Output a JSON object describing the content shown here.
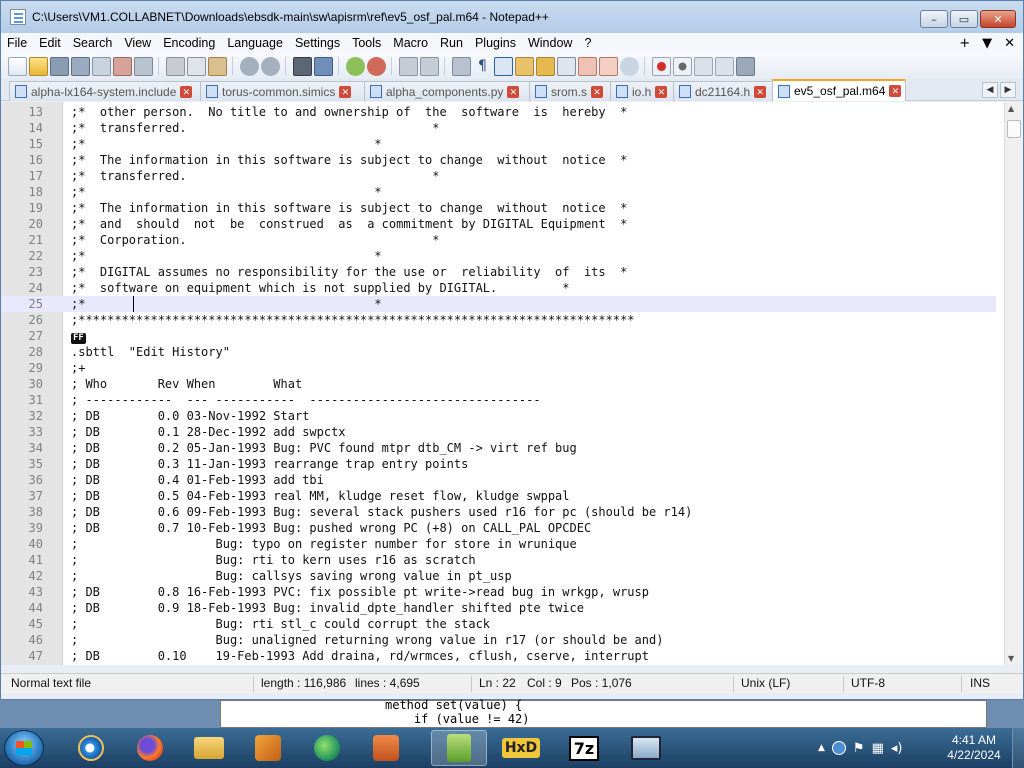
{
  "window": {
    "title": "C:\\Users\\VM1.COLLABNET\\Downloads\\ebsdk-main\\sw\\apisrm\\ref\\ev5_osf_pal.m64 - Notepad++",
    "min": "–",
    "max": "▭",
    "close": "✕"
  },
  "menu": [
    "File",
    "Edit",
    "Search",
    "View",
    "Encoding",
    "Language",
    "Settings",
    "Tools",
    "Macro",
    "Run",
    "Plugins",
    "Window",
    "?"
  ],
  "menu_right": {
    "plus": "+",
    "down": "▼",
    "close": "✕"
  },
  "tabs": [
    {
      "label": "alpha-lx164-system.include"
    },
    {
      "label": "torus-common.simics"
    },
    {
      "label": "alpha_components.py"
    },
    {
      "label": "srom.s"
    },
    {
      "label": "io.h"
    },
    {
      "label": "dc21164.h"
    },
    {
      "label": "ev5_osf_pal.m64",
      "active": true
    }
  ],
  "tab_nav": {
    "left": "◀",
    "right": "▶"
  },
  "editor": {
    "current_line": 25,
    "lines": [
      {
        "n": "13",
        "t": ";*  other person.  No title to and ownership of  the  software  is  hereby  *"
      },
      {
        "n": "14",
        "t": ";*  transferred.                                  *"
      },
      {
        "n": "15",
        "t": ";*                                        *"
      },
      {
        "n": "16",
        "t": ";*  The information in this software is subject to change  without  notice  *"
      },
      {
        "n": "17",
        "t": ";*  transferred.                                  *"
      },
      {
        "n": "18",
        "t": ";*                                        *"
      },
      {
        "n": "19",
        "t": ";*  The information in this software is subject to change  without  notice  *"
      },
      {
        "n": "20",
        "t": ";*  and  should  not  be  construed  as  a commitment by DIGITAL Equipment  *"
      },
      {
        "n": "21",
        "t": ";*  Corporation.                                  *"
      },
      {
        "n": "22",
        "t": ";*                                        *"
      },
      {
        "n": "23",
        "t": ";*  DIGITAL assumes no responsibility for the use or  reliability  of  its  *"
      },
      {
        "n": "24",
        "t": ";*  software on equipment which is not supplied by DIGITAL.         *"
      },
      {
        "n": "25",
        "t": ";*                                        *"
      },
      {
        "n": "26",
        "t": ";*****************************************************************************"
      },
      {
        "n": "27",
        "t": "",
        "ff": "FF"
      },
      {
        "n": "28",
        "t": ".sbttl  \"Edit History\""
      },
      {
        "n": "29",
        "t": ";+"
      },
      {
        "n": "30",
        "t": "; Who       Rev When        What"
      },
      {
        "n": "31",
        "t": "; ------------  --- -----------  --------------------------------"
      },
      {
        "n": "32",
        "t": "; DB        0.0 03-Nov-1992 Start"
      },
      {
        "n": "33",
        "t": "; DB        0.1 28-Dec-1992 add swpctx"
      },
      {
        "n": "34",
        "t": "; DB        0.2 05-Jan-1993 Bug: PVC found mtpr dtb_CM -> virt ref bug"
      },
      {
        "n": "35",
        "t": "; DB        0.3 11-Jan-1993 rearrange trap entry points"
      },
      {
        "n": "36",
        "t": "; DB        0.4 01-Feb-1993 add tbi"
      },
      {
        "n": "37",
        "t": "; DB        0.5 04-Feb-1993 real MM, kludge reset flow, kludge swppal"
      },
      {
        "n": "38",
        "t": "; DB        0.6 09-Feb-1993 Bug: several stack pushers used r16 for pc (should be r14)"
      },
      {
        "n": "39",
        "t": "; DB        0.7 10-Feb-1993 Bug: pushed wrong PC (+8) on CALL_PAL OPCDEC"
      },
      {
        "n": "40",
        "t": ";                   Bug: typo on register number for store in wrunique"
      },
      {
        "n": "41",
        "t": ";                   Bug: rti to kern uses r16 as scratch"
      },
      {
        "n": "42",
        "t": ";                   Bug: callsys saving wrong value in pt_usp"
      },
      {
        "n": "43",
        "t": "; DB        0.8 16-Feb-1993 PVC: fix possible pt write->read bug in wrkgp, wrusp"
      },
      {
        "n": "44",
        "t": "; DB        0.9 18-Feb-1993 Bug: invalid_dpte_handler shifted pte twice"
      },
      {
        "n": "45",
        "t": ";                   Bug: rti stl_c could corrupt the stack"
      },
      {
        "n": "46",
        "t": ";                   Bug: unaligned returning wrong value in r17 (or should be and)"
      },
      {
        "n": "47",
        "t": "; DB        0.10    19-Feb-1993 Add draina, rd/wrmces, cflush, cserve, interrupt"
      }
    ]
  },
  "status": {
    "type": "Normal text file",
    "length": "length : 116,986",
    "lines": "lines : 4,695",
    "ln": "Ln : 22",
    "col": "Col : 9",
    "pos": "Pos : 1,076",
    "eol": "Unix (LF)",
    "enc": "UTF-8",
    "mode": "INS"
  },
  "behind_window": {
    "line1": "method set(value) {",
    "line2": "    if (value != 42)"
  },
  "taskbar": {
    "time": "4:41 AM",
    "date": "4/22/2024"
  }
}
